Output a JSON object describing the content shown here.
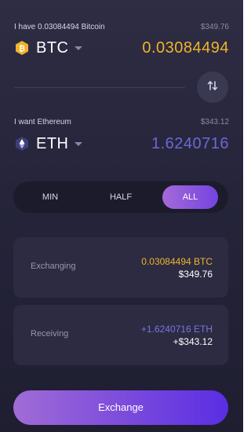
{
  "have": {
    "label": "I have 0.03084494 Bitcoin",
    "fiat": "$349.76",
    "currency": "BTC",
    "amount": "0.03084494",
    "icon": "bitcoin-icon",
    "color": "#f0b429"
  },
  "want": {
    "label": "I want Ethereum",
    "fiat": "$343.12",
    "currency": "ETH",
    "amount": "1.6240716",
    "icon": "ethereum-icon",
    "color": "#6c68d6"
  },
  "swap": {
    "icon": "swap-arrows-icon"
  },
  "amount_selector": {
    "options": [
      "MIN",
      "HALF",
      "ALL"
    ],
    "selected": "ALL"
  },
  "summary": {
    "exchanging": {
      "label": "Exchanging",
      "crypto": "0.03084494 BTC",
      "fiat": "$349.76"
    },
    "receiving": {
      "label": "Receiving",
      "crypto": "+1.6240716 ETH",
      "fiat": "+$343.12"
    }
  },
  "exchange_button": {
    "label": "Exchange"
  },
  "colors": {
    "accent_start": "#a46ad8",
    "accent_end": "#5a2de3",
    "background": "#25243a"
  }
}
